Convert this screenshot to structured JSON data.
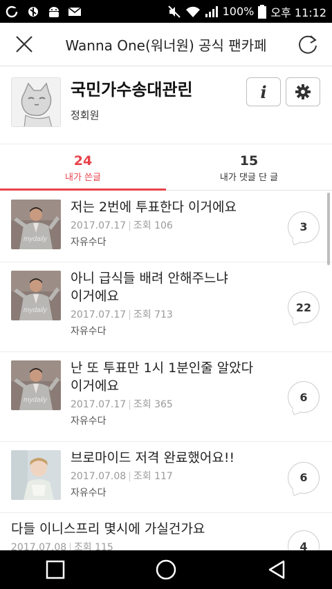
{
  "status_bar": {
    "battery_percent": "100%",
    "time": "오후 11:12"
  },
  "app_bar": {
    "title": "Wanna One(워너원) 공식 팬카페"
  },
  "profile": {
    "nickname": "국민가수송대관린",
    "real_name": "정회원",
    "info_label": "i"
  },
  "tabs": [
    {
      "count": "24",
      "label": "내가 쓴글",
      "active": true
    },
    {
      "count": "15",
      "label": "내가 댓글 단 글",
      "active": false
    }
  ],
  "posts": [
    {
      "title_lines": [
        "저는 2번에 투표한다 이거에요"
      ],
      "date": "2017.07.17",
      "views": "조회 106",
      "board": "자유수다",
      "comments": "3",
      "thumb": "man-thumbnail"
    },
    {
      "title_lines": [
        "아니 급식들 배려 안해주느냐",
        "이거에요"
      ],
      "date": "2017.07.17",
      "views": "조회 713",
      "board": "자유수다",
      "comments": "22",
      "thumb": "man-thumbnail"
    },
    {
      "title_lines": [
        "난 또 투표만 1시 1분인줄 알았다",
        "이거에요"
      ],
      "date": "2017.07.17",
      "views": "조회 365",
      "board": "자유수다",
      "comments": "6",
      "thumb": "man-thumbnail"
    },
    {
      "title_lines": [
        "브로마이드 저격 완료했어요!!"
      ],
      "date": "2017.07.08",
      "views": "조회 117",
      "board": "자유수다",
      "comments": "6",
      "thumb": "idol-thumbnail"
    },
    {
      "title_lines": [
        "다들 이니스프리 몇시에 가실건가요"
      ],
      "date": "2017.07.08",
      "views": "조회 115",
      "board": "",
      "comments": "4",
      "thumb": ""
    }
  ],
  "thumb_watermark": "mydaily",
  "colors": {
    "accent": "#e8434b",
    "status_bar": "#000000",
    "nav_bar": "#000000"
  }
}
